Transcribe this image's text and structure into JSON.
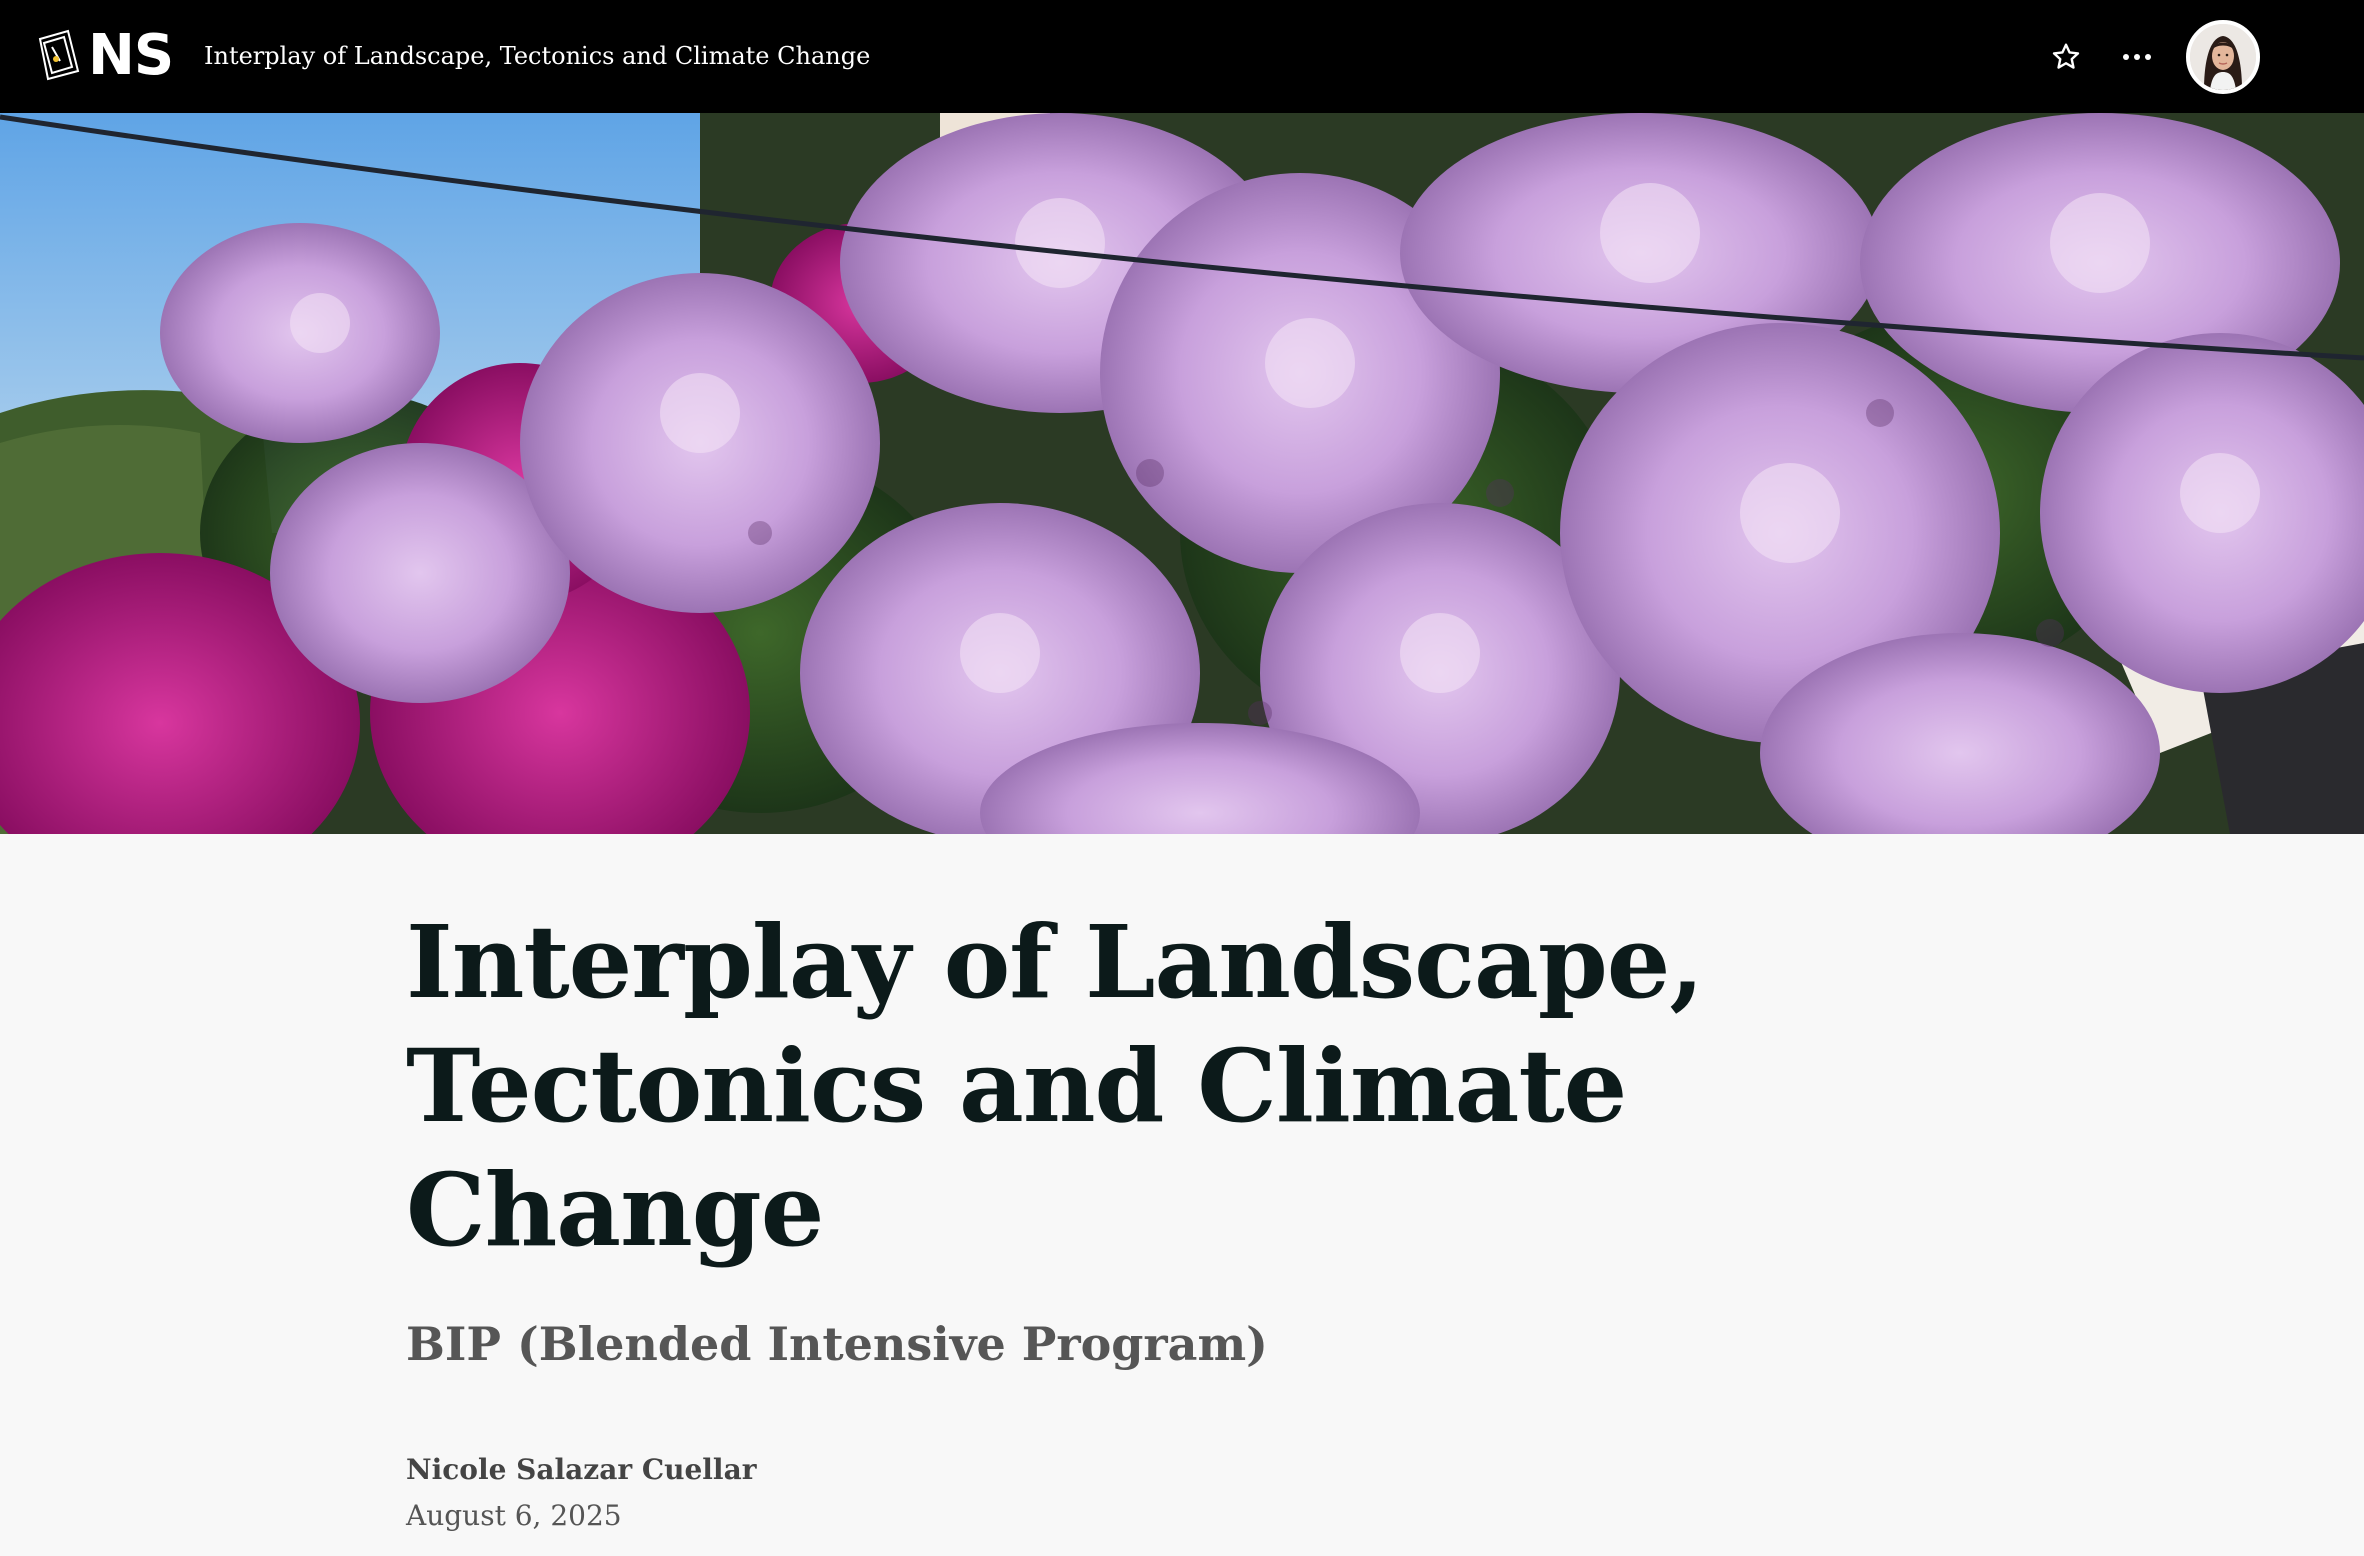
{
  "topbar": {
    "logo_text": "NS",
    "title": "Interplay of Landscape, Tectonics and Climate Change",
    "star_icon": "star-outline-icon",
    "more_icon": "more-horizontal-icon",
    "avatar_icon": "user-avatar"
  },
  "hero": {
    "image_subject": "lilac and magenta bougainvillea flowers against blue sky"
  },
  "article": {
    "title": "Interplay of Landscape, Tectonics and Climate Change",
    "subtitle": "BIP (Blended Intensive Program)",
    "author": "Nicole Salazar Cuellar",
    "date": "August 6, 2025"
  },
  "colors": {
    "topbar_bg": "#000000",
    "page_bg": "#f8f8f8",
    "title_text": "#0c1a1a",
    "subtitle_text": "#565656"
  }
}
